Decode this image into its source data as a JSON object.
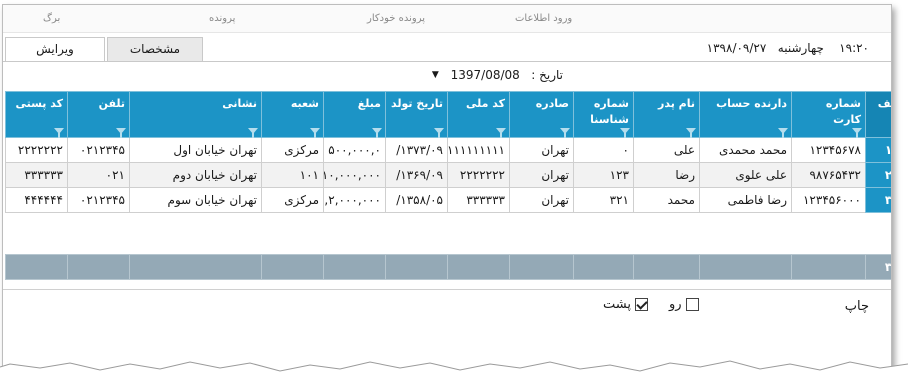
{
  "topnav": {
    "items": [
      "ورود اطلاعات",
      "پرونده خودکار",
      "پرونده",
      "برگ"
    ]
  },
  "tabs": {
    "edit": "ویرایش",
    "spec": "مشخصات"
  },
  "clock": {
    "time": "۱۹:۲۰",
    "weekday": "چهارشنبه",
    "date": "۱۳۹۸/۰۹/۲۷"
  },
  "date_filter": {
    "label": "تاریخ :",
    "value": "1397/08/08"
  },
  "grid": {
    "columns": {
      "row": "ردیف",
      "card_number": "شماره کارت",
      "account_holder": "دارنده حساب",
      "father_name": "نام پدر",
      "id_number": "شماره شناسنا",
      "issued": "صادره",
      "national_code": "کد ملی",
      "birth_date": "تاریخ تولد",
      "amount": "مبلغ",
      "branch": "شعبه",
      "address": "نشانی",
      "phone": "تلفن",
      "postal_code": "کد پستی"
    },
    "rows": [
      {
        "row": "۱",
        "card_number": "۱۲۳۴۵۶۷۸",
        "account_holder": "محمد محمدی",
        "father_name": "علی",
        "id_number": "۰",
        "issued": "تهران",
        "national_code": "۱۱۱۱۱۱۱۱۱۱",
        "birth_date": "۱۳۷۳/۰۹/",
        "amount": "۵۰۰,۰۰۰,۰",
        "branch": "مرکزی",
        "address": "تهران خیابان اول",
        "phone": "۰۲۱۲۳۴۵",
        "postal_code": "۲۲۲۲۲۲۲"
      },
      {
        "row": "۲",
        "card_number": "۹۸۷۶۵۴۳۲",
        "account_holder": "علی علوی",
        "father_name": "رضا",
        "id_number": "۱۲۳",
        "issued": "تهران",
        "national_code": "۲۲۲۲۲۲۲",
        "birth_date": "۱۳۶۹/۰۹/",
        "amount": "۱۰,۰۰۰,۰۰۰",
        "branch": "۱۰۱",
        "address": "تهران خیابان دوم",
        "phone": "۰۲۱",
        "postal_code": "۳۳۳۳۳۳"
      },
      {
        "row": "۳",
        "card_number": "۱۲۳۴۵۶۰۰۰",
        "account_holder": "رضا فاطمی",
        "father_name": "محمد",
        "id_number": "۳۲۱",
        "issued": "تهران",
        "national_code": "۳۳۳۳۳۳",
        "birth_date": "۱۳۵۸/۰۵/",
        "amount": "۲,۰۰۰,۰۰۰,",
        "branch": "مرکزی",
        "address": "تهران خیابان سوم",
        "phone": "۰۲۱۲۳۴۵",
        "postal_code": "۴۴۴۴۴۴"
      }
    ],
    "footer_count": "۳"
  },
  "print": {
    "label": "چاپ",
    "front_label": "رو",
    "back_label": "پشت",
    "front_checked": false,
    "back_checked": true
  }
}
